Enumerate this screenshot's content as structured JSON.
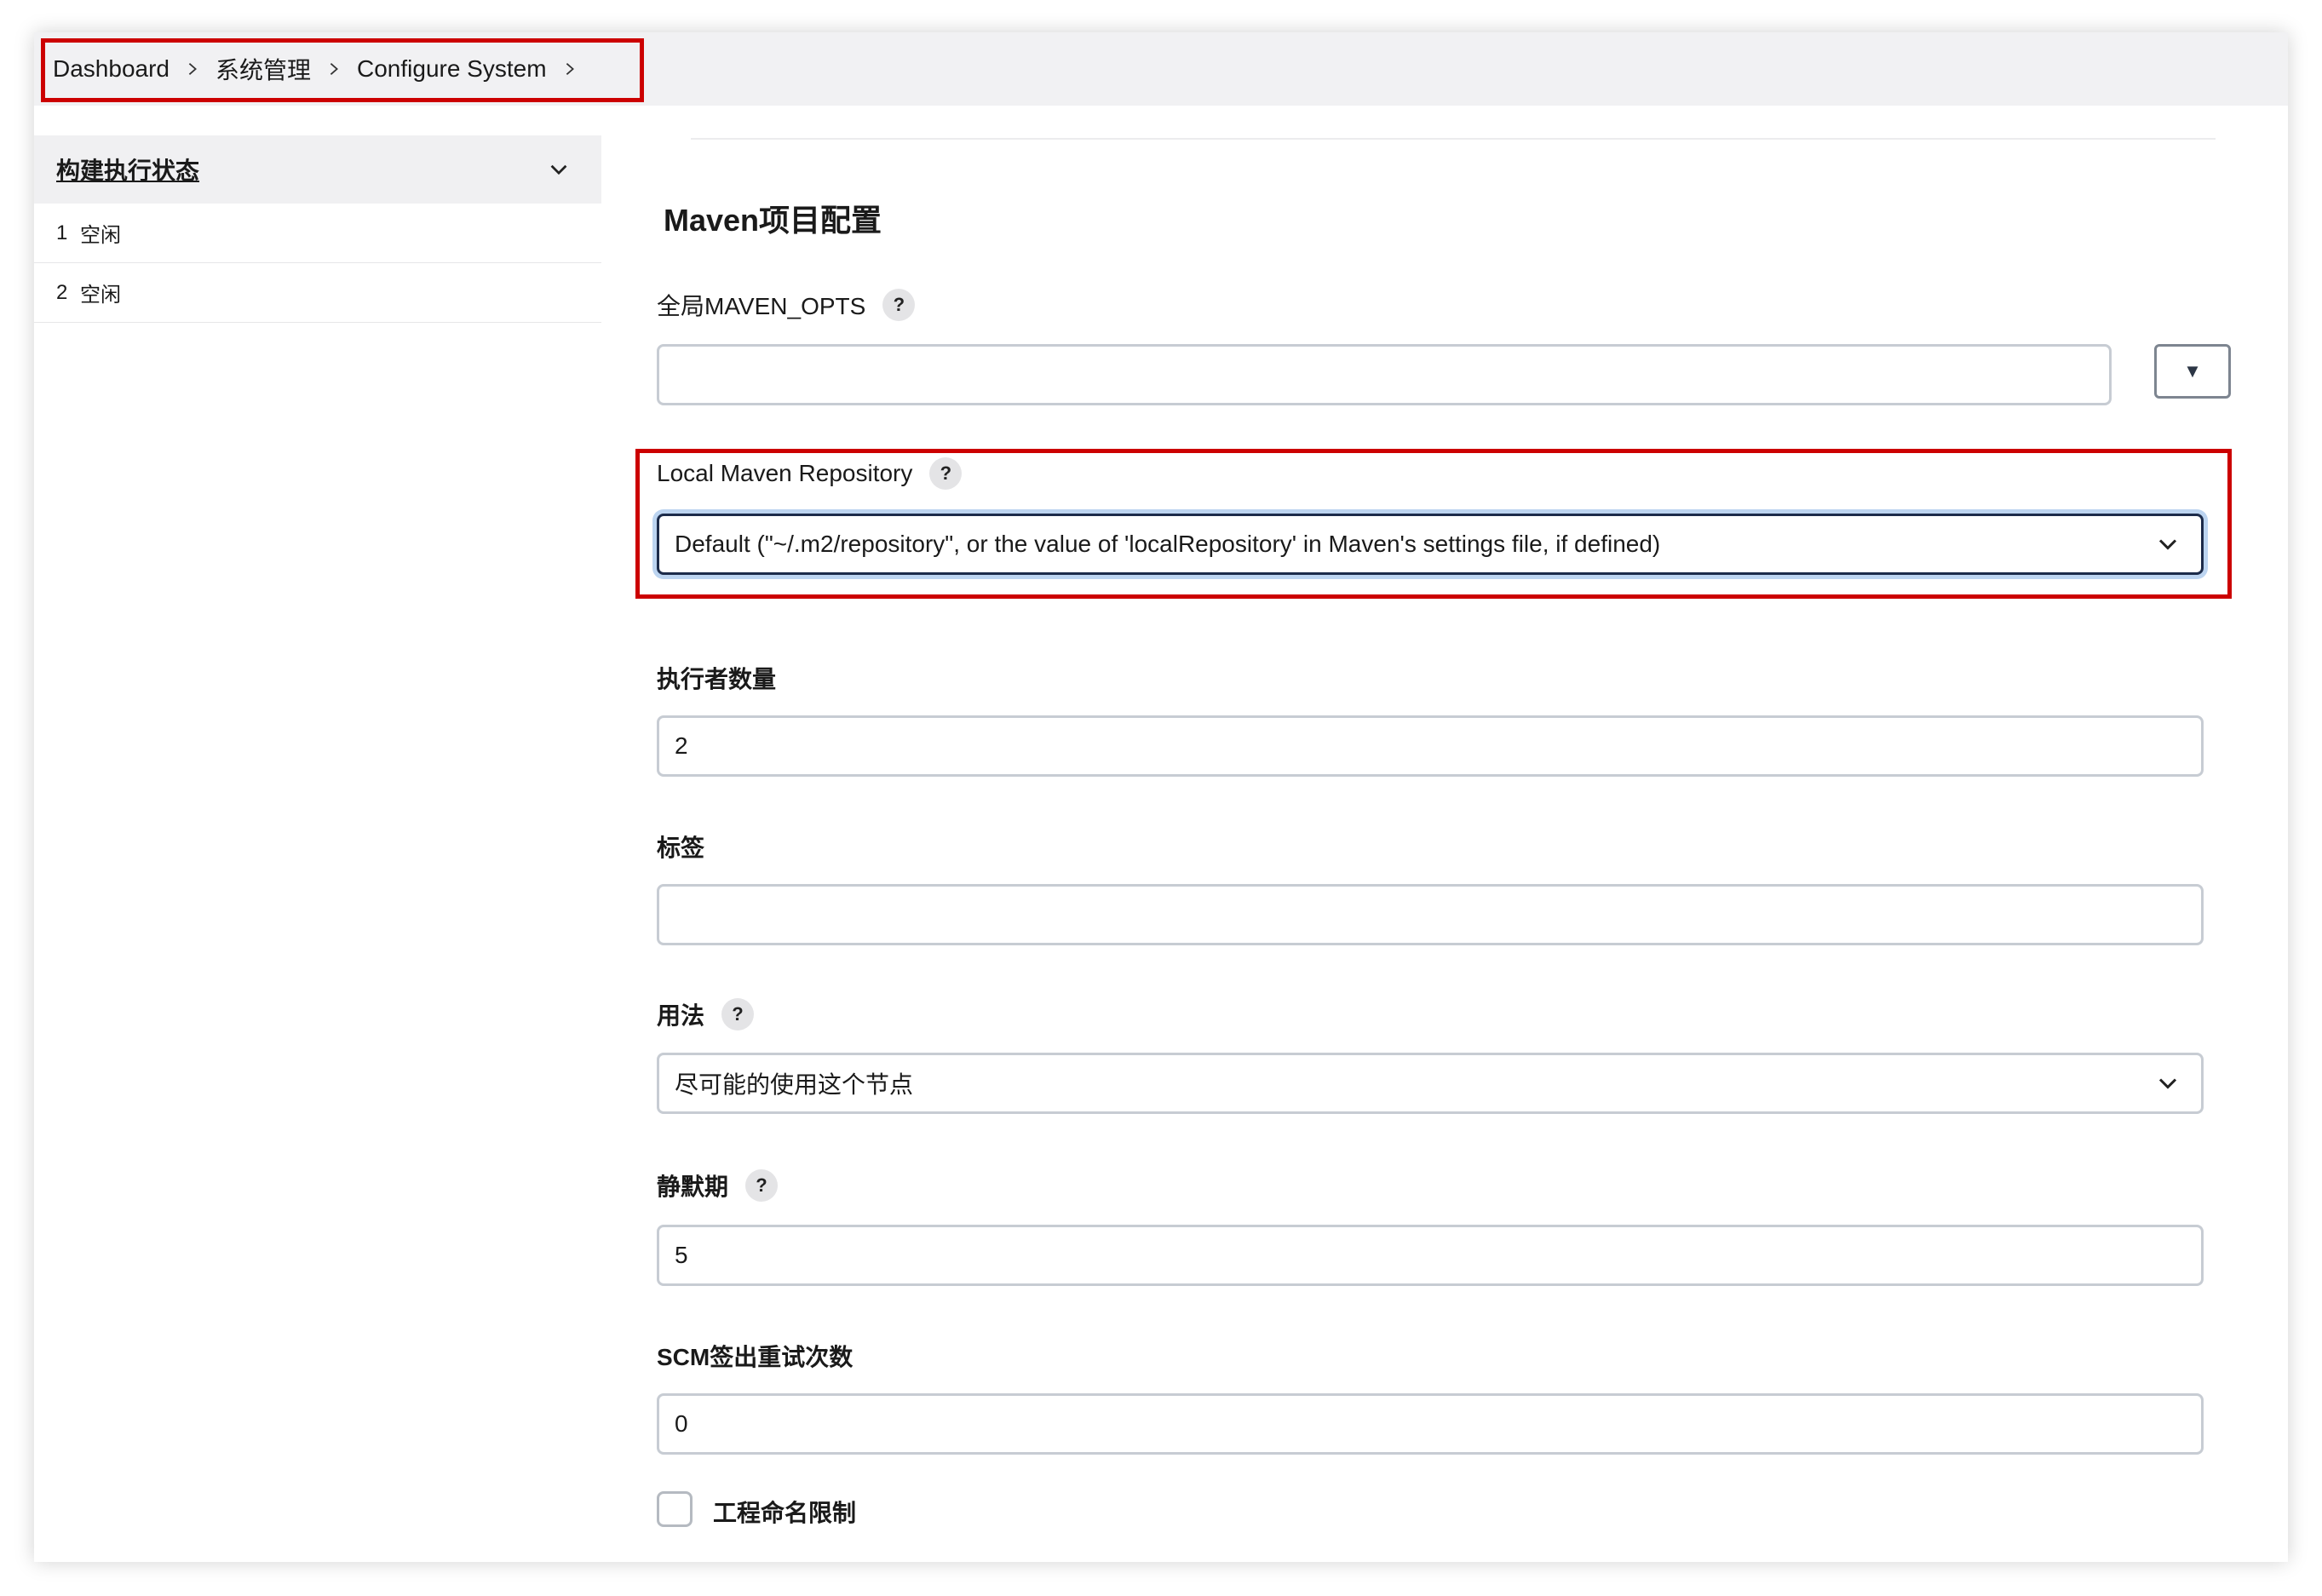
{
  "breadcrumb": {
    "items": [
      "Dashboard",
      "系统管理",
      "Configure System"
    ]
  },
  "sidebar": {
    "executor_status_title": "构建执行状态",
    "executors": [
      {
        "num": "1",
        "status": "空闲"
      },
      {
        "num": "2",
        "status": "空闲"
      }
    ]
  },
  "main": {
    "section_title": "Maven项目配置",
    "maven_opts": {
      "label": "全局MAVEN_OPTS",
      "help": "?",
      "value": ""
    },
    "local_repo": {
      "label": "Local Maven Repository",
      "help": "?",
      "selected": "Default (\"~/.m2/repository\", or the value of 'localRepository' in Maven's settings file, if defined)"
    },
    "num_executors": {
      "label": "执行者数量",
      "value": "2"
    },
    "labels": {
      "label": "标签",
      "value": ""
    },
    "usage": {
      "label": "用法",
      "help": "?",
      "selected": "尽可能的使用这个节点"
    },
    "quiet_period": {
      "label": "静默期",
      "help": "?",
      "value": "5"
    },
    "scm_retry": {
      "label": "SCM签出重试次数",
      "value": "0"
    },
    "project_naming": {
      "label": "工程命名限制",
      "checked": false
    }
  },
  "highlight_color": "#cc0000"
}
